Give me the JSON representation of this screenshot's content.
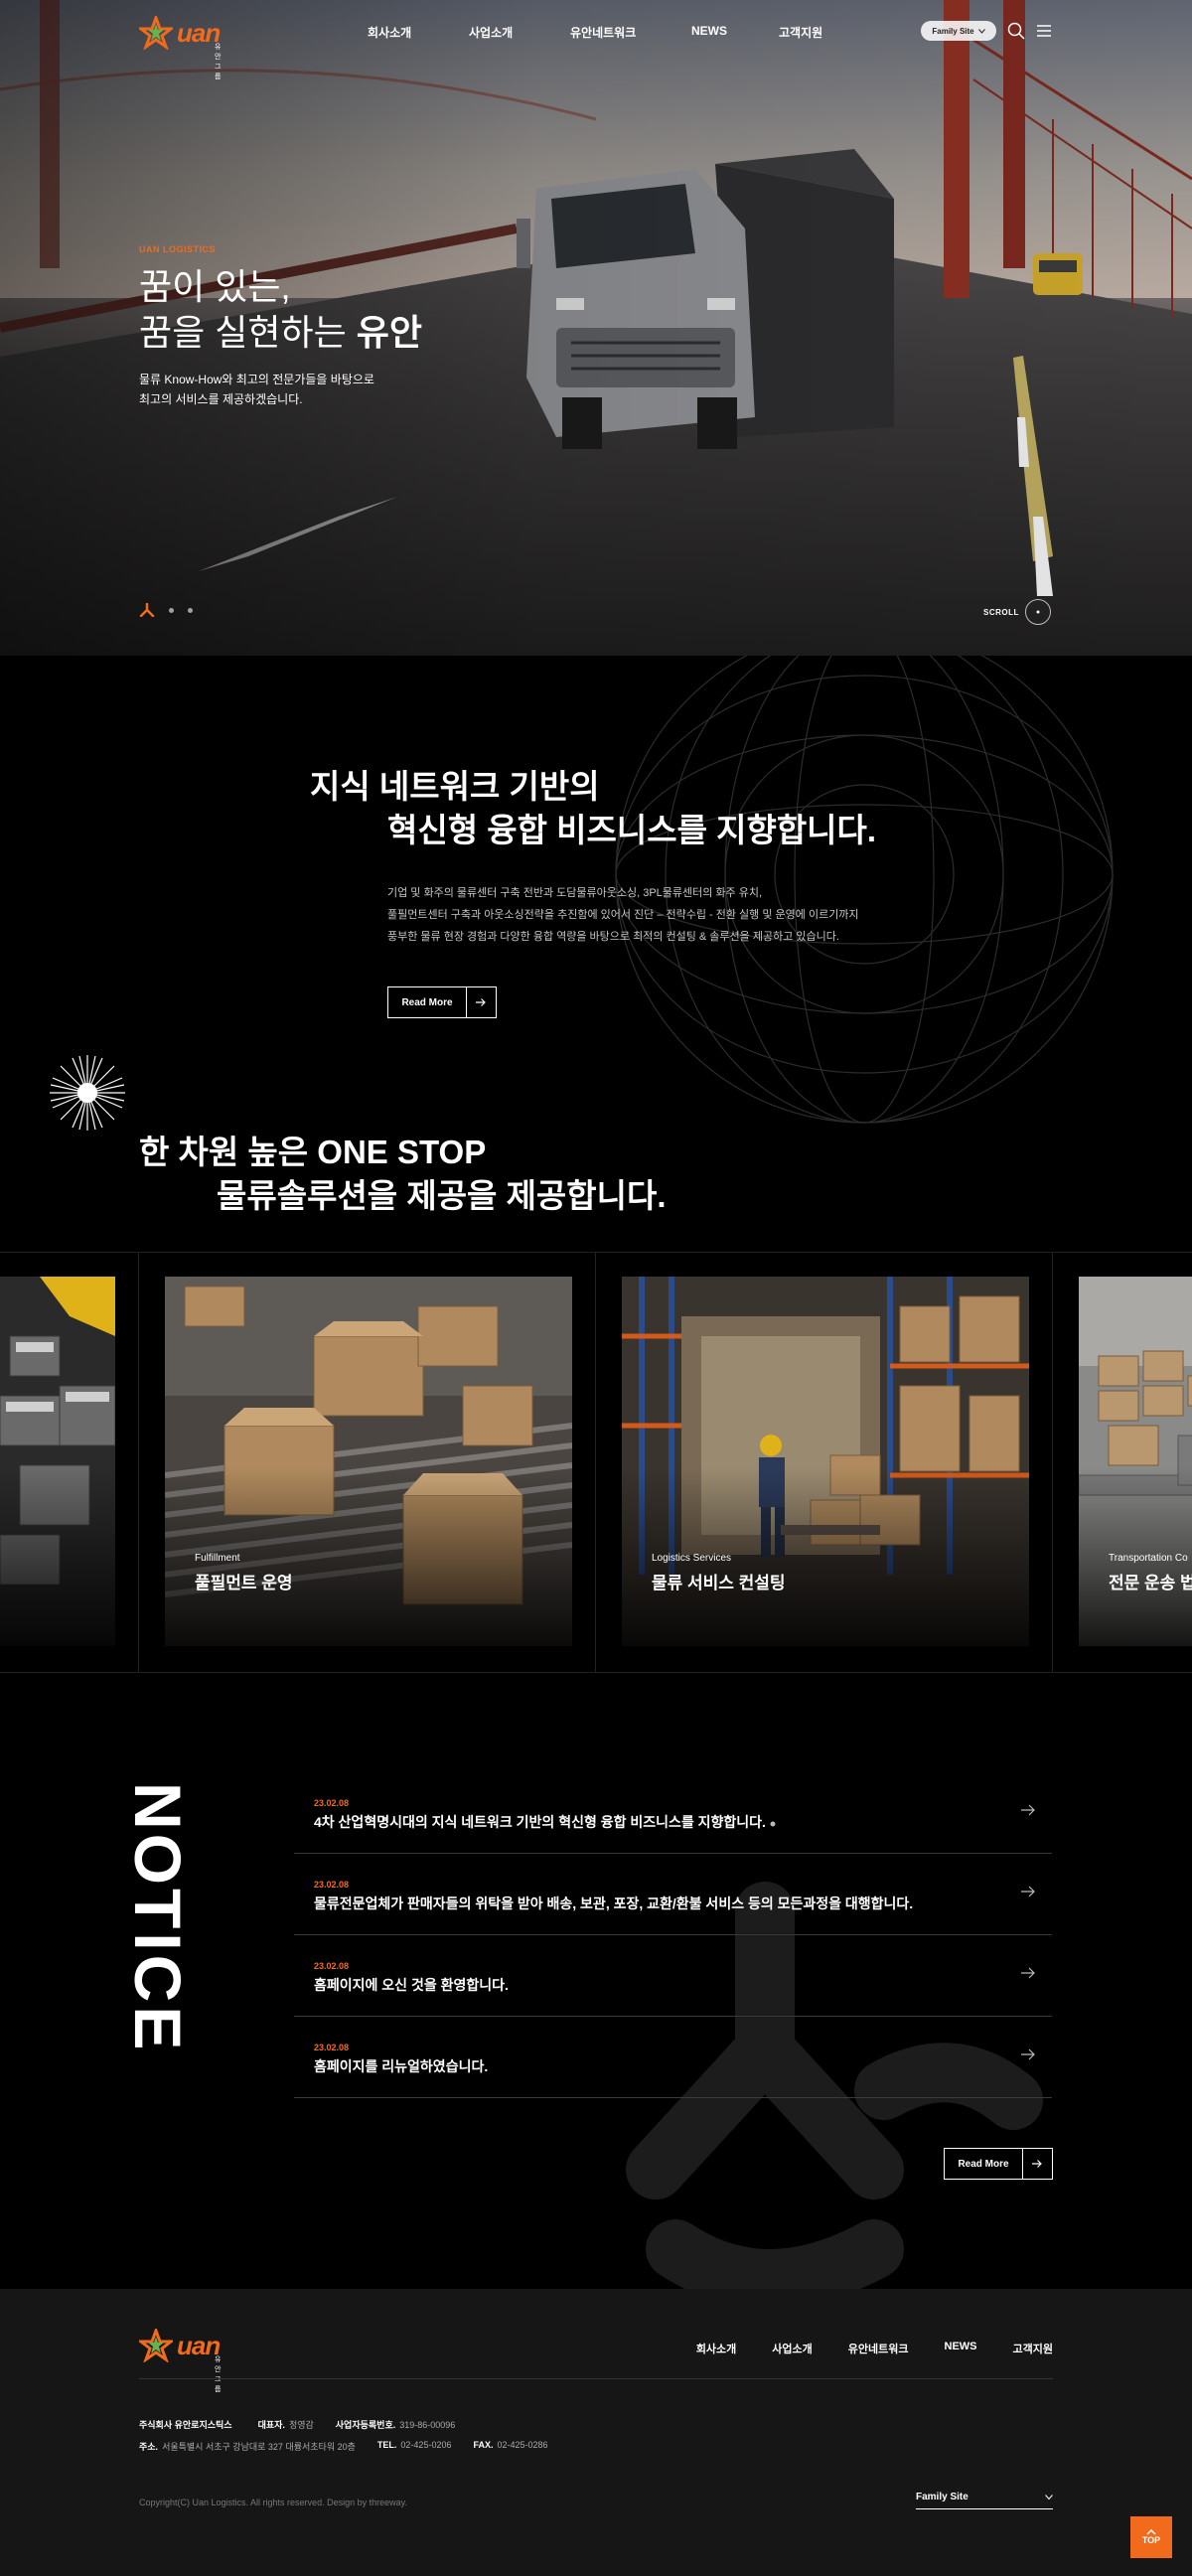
{
  "brand": {
    "logo_text": "uan",
    "logo_sub": "유안그룹"
  },
  "nav": [
    "회사소개",
    "사업소개",
    "유안네트워크",
    "NEWS",
    "고객지원"
  ],
  "header": {
    "family_site": "Family Site"
  },
  "hero": {
    "eyebrow": "UAN LOGISTICS",
    "title_line1": "꿈이 있는,",
    "title_line2_prefix": "꿈을 실현하는 ",
    "title_line2_bold": "유안",
    "desc_line1": "물류 Know-How와 최고의 전문가들을 바탕으로",
    "desc_line2": "최고의 서비스를 제공하겠습니다.",
    "scroll_label": "SCROLL"
  },
  "about": {
    "title_line1": "지식 네트워크 기반의",
    "title_line2": "혁신형 융합 비즈니스를 지향합니다.",
    "desc_line1": "기업 및 화주의 물류센터 구축 전반과 도담물류아웃소싱, 3PL물류센터의 화주 유치,",
    "desc_line2": "풀필먼트센터 구축과 아웃소싱전략을 추진함에 있어서 진단 – 전략수립 - 전환 실행 및 운영에 이르기까지",
    "desc_line3": "풍부한 물류 현장 경험과 다양한 융합 역량을 바탕으로 최적의 컨설팅 & 솔루션을 제공하고 있습니다.",
    "read_more": "Read More",
    "sub_title_line1": "한 차원 높은 ONE STOP",
    "sub_title_line2": "물류솔루션을 제공을 제공합니다."
  },
  "services": [
    {
      "category": "",
      "name": ""
    },
    {
      "category": "Fulfillment",
      "name": "풀필먼트 운영"
    },
    {
      "category": "Logistics Services",
      "name": "물류 서비스 컨설팅"
    },
    {
      "category": "Transportation Co",
      "name": "전문 운송 법인"
    }
  ],
  "notice": {
    "title": "NOTICE",
    "items": [
      {
        "date": "23.02.08",
        "title": "4차 산업혁명시대의 지식 네트워크 기반의 혁신형 융합 비즈니스를 지향합니다."
      },
      {
        "date": "23.02.08",
        "title": "물류전문업체가 판매자들의 위탁을 받아 배송, 보관, 포장, 교환/환불 서비스 등의 모든과정을 대행합니다."
      },
      {
        "date": "23.02.08",
        "title": "홈페이지에 오신 것을 환영합니다."
      },
      {
        "date": "23.02.08",
        "title": "홈페이지를 리뉴얼하였습니다."
      }
    ],
    "read_more": "Read More"
  },
  "footer": {
    "nav": [
      "회사소개",
      "사업소개",
      "유안네트워크",
      "NEWS",
      "고객지원"
    ],
    "company": "주식회사 유안로지스틱스",
    "ceo_label": "대표자.",
    "ceo": "정영감",
    "biz_label": "사업자등록번호.",
    "biz": "319-86-00096",
    "addr_label": "주소.",
    "addr": "서울특별시 서초구 강남대로 327 대륭서초타워 20층",
    "tel_label": "TEL.",
    "tel": "02-425-0206",
    "fax_label": "FAX.",
    "fax": "02-425-0286",
    "copyright": "Copyright(C) Uan Logistics. All rights reserved. Design by threeway.",
    "family_site": "Family Site",
    "top": "TOP"
  },
  "colors": {
    "accent": "#f26b1d",
    "bg": "#000000",
    "footer_bg": "#161616"
  }
}
